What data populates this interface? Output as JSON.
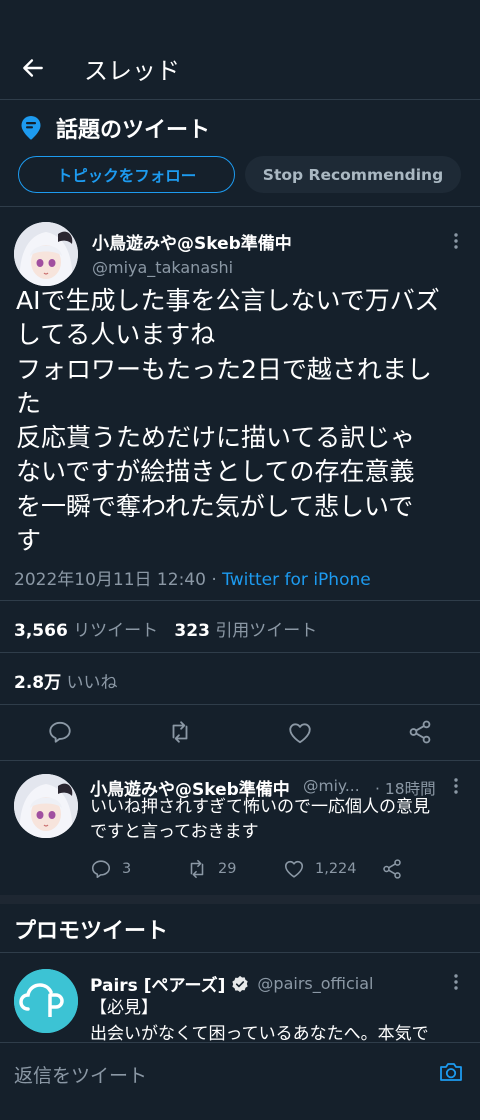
{
  "header": {
    "title": "スレッド",
    "back_icon": "arrow-left-icon"
  },
  "topic": {
    "label": "話題のツイート",
    "icon": "topic-pin-icon",
    "follow_label": "トピックをフォロー",
    "stop_label": "Stop Recommending"
  },
  "tweet": {
    "name": "小鳥遊みや@Skeb準備中",
    "handle": "@miya_takanashi",
    "lines": [
      "AIで生成した事を公言しないで万バズ",
      "してる人いますね",
      "フォロワーもたった2日で越されまし",
      "た",
      "反応貰うためだけに描いてる訳じゃ",
      "ないですが絵描きとしての存在意義",
      "を一瞬で奪われた気がして悲しいで",
      "す"
    ],
    "timestamp": "2022年10月11日 12:40",
    "separator": " · ",
    "source": "Twitter for iPhone",
    "retweets": "3,566",
    "retweets_label": "リツイート",
    "quotes": "323",
    "quotes_label": "引用ツイート",
    "likes": "2.8万",
    "likes_label": "いいね"
  },
  "reply": {
    "name": "小鳥遊みや@Skeb準備中",
    "handle": "@miy...",
    "time": "· 18時間",
    "lines": [
      "いいね押されすぎて怖いので一応個人の意見",
      "ですと言っておきます"
    ],
    "reply_count": "3",
    "retweet_count": "29",
    "like_count": "1,224"
  },
  "promo": {
    "section_title": "プロモツイート",
    "name": "Pairs [ペアーズ]",
    "handle": "@pairs_official",
    "line1": "【必見】",
    "line2": "出会いがなくて困っているあなたへ。本気で"
  },
  "compose": {
    "placeholder": "返信をツイート",
    "icon": "camera-icon"
  },
  "colors": {
    "background": "#15202b",
    "accent": "#1d9bf0",
    "muted": "#8b98a5",
    "divider": "#2f3d4a"
  }
}
